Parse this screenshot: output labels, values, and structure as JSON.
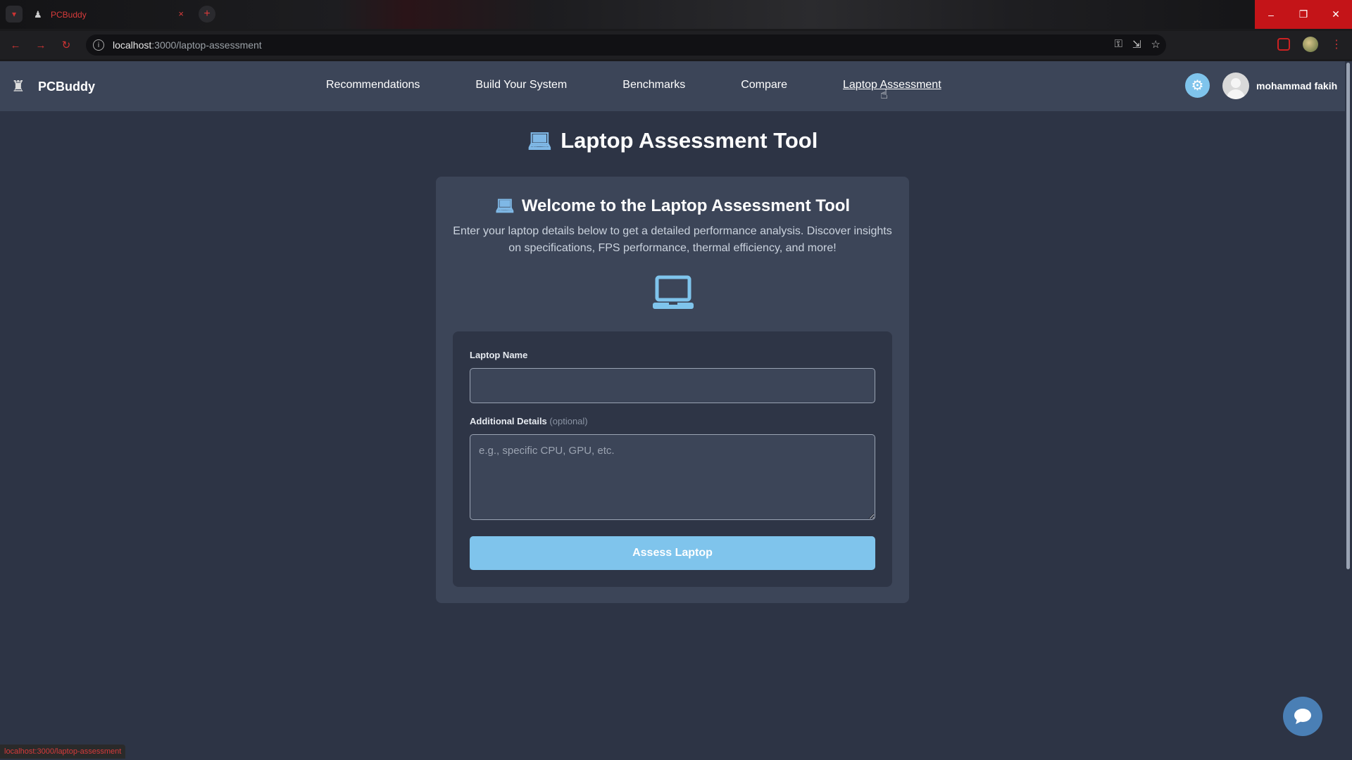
{
  "browser": {
    "tab_title": "PCBuddy",
    "url_host": "localhost",
    "url_path": ":3000/laptop-assessment",
    "status_url": "localhost:3000/laptop-assessment",
    "tab_close": "×",
    "new_tab": "+",
    "win_minimize": "–",
    "win_restore": "❐",
    "win_close": "✕"
  },
  "header": {
    "brand": "PCBuddy",
    "nav": [
      {
        "label": "Recommendations"
      },
      {
        "label": "Build Your System"
      },
      {
        "label": "Benchmarks"
      },
      {
        "label": "Compare"
      },
      {
        "label": "Laptop Assessment"
      }
    ],
    "active_nav": "Laptop Assessment",
    "username": "mohammad fakih"
  },
  "page": {
    "title": "Laptop Assessment Tool"
  },
  "card": {
    "title": "Welcome to the Laptop Assessment Tool",
    "description": "Enter your laptop details below to get a detailed performance analysis. Discover insights on specifications, FPS performance, thermal efficiency, and more!",
    "form": {
      "laptop_name_label": "Laptop Name",
      "laptop_name_value": "",
      "details_label": "Additional Details",
      "details_optional": "(optional)",
      "details_placeholder": "e.g., specific CPU, GPU, etc.",
      "submit_label": "Assess Laptop"
    }
  },
  "colors": {
    "page_bg": "#2d3445",
    "header_bg": "#3c4558",
    "accent": "#7fc4ec",
    "chat_button": "#4a7fb5"
  },
  "icons": {
    "brand": "pc-user-icon",
    "title": "laptop-icon",
    "theme": "gear-icon",
    "chat": "chat-bubble-icon"
  }
}
